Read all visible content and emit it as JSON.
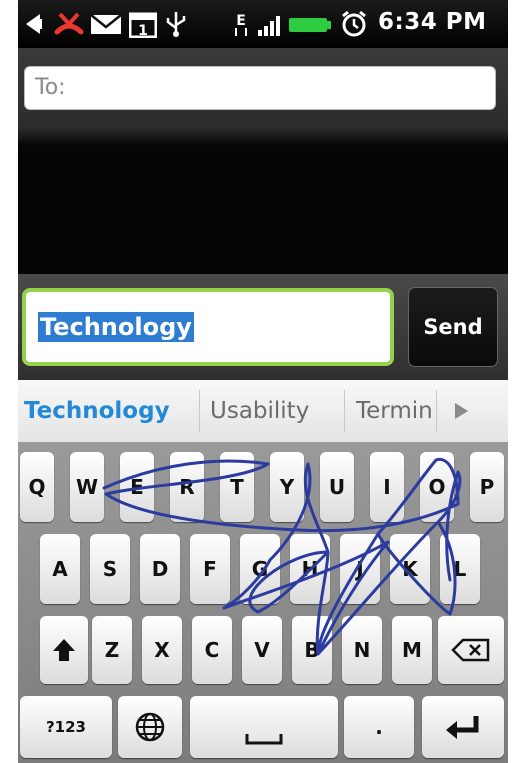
{
  "status_bar": {
    "time": "6:34 PM",
    "icons": [
      "back-arrow-icon",
      "missed-call-icon",
      "mail-icon",
      "calendar-icon",
      "usb-icon",
      "edge-data-icon",
      "signal-icon",
      "battery-icon",
      "alarm-icon"
    ],
    "calendar_day": "1",
    "edge_label": "E"
  },
  "compose": {
    "to_placeholder": "To:",
    "message_text": "Technology",
    "send_label": "Send"
  },
  "suggestions": {
    "items": [
      "Technology",
      "Usability",
      "Termin"
    ],
    "active_color": "#2289d6"
  },
  "keyboard": {
    "row1": [
      "Q",
      "W",
      "E",
      "R",
      "T",
      "Y",
      "U",
      "I",
      "O",
      "P"
    ],
    "row2": [
      "A",
      "S",
      "D",
      "F",
      "G",
      "H",
      "J",
      "K",
      "L"
    ],
    "row3": [
      "Z",
      "X",
      "C",
      "V",
      "B",
      "N",
      "M"
    ],
    "symbols_label": "?123",
    "period_label": ".",
    "icons": [
      "shift-icon",
      "delete-icon",
      "globe-icon",
      "space-icon",
      "enter-icon"
    ],
    "swipe_color": "#2b3b9f"
  },
  "colors": {
    "selection": "#2e7dd3",
    "field_border": "#95d14a",
    "battery": "#2ecc40",
    "missed_call": "#e8382f"
  }
}
